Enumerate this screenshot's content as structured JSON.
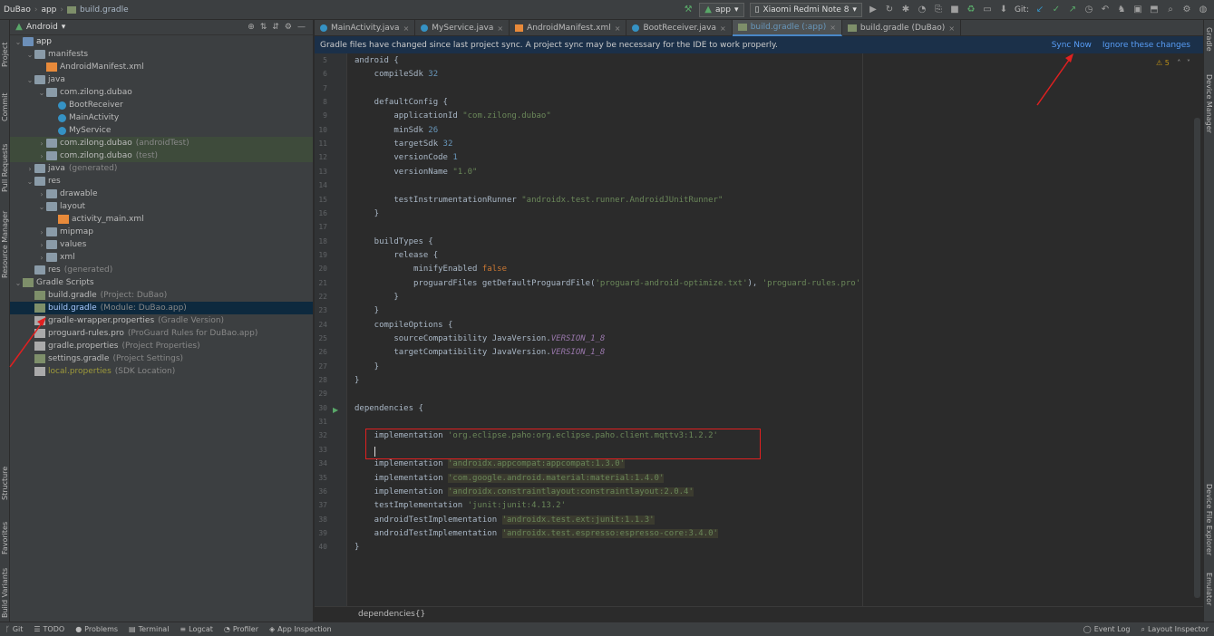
{
  "titlebar": {
    "project": "DuBao",
    "module": "app",
    "file": "build.gradle",
    "run_config": "app",
    "device": "Xiaomi Redmi Note 8",
    "git_label": "Git:"
  },
  "left_strip": [
    "Project",
    "Commit",
    "Pull Requests",
    "Resource Manager",
    "Structure",
    "Favorites",
    "Build Variants"
  ],
  "right_strip": [
    "Gradle",
    "Device Manager",
    "Device File Explorer",
    "Emulator"
  ],
  "project_panel": {
    "view": "Android",
    "tree": [
      {
        "label": "app",
        "hint": "",
        "indent": 0,
        "arrow": "v",
        "icon": "folder-blue",
        "bold": true
      },
      {
        "label": "manifests",
        "hint": "",
        "indent": 1,
        "arrow": "v",
        "icon": "folder"
      },
      {
        "label": "AndroidManifest.xml",
        "hint": "",
        "indent": 2,
        "arrow": "",
        "icon": "xml"
      },
      {
        "label": "java",
        "hint": "",
        "indent": 1,
        "arrow": "v",
        "icon": "folder"
      },
      {
        "label": "com.zilong.dubao",
        "hint": "",
        "indent": 2,
        "arrow": "v",
        "icon": "folder"
      },
      {
        "label": "BootReceiver",
        "hint": "",
        "indent": 3,
        "arrow": "",
        "icon": "class"
      },
      {
        "label": "MainActivity",
        "hint": "",
        "indent": 3,
        "arrow": "",
        "icon": "class"
      },
      {
        "label": "MyService",
        "hint": "",
        "indent": 3,
        "arrow": "",
        "icon": "class"
      },
      {
        "label": "com.zilong.dubao",
        "hint": "(androidTest)",
        "indent": 2,
        "arrow": ">",
        "icon": "folder",
        "green": true
      },
      {
        "label": "com.zilong.dubao",
        "hint": "(test)",
        "indent": 2,
        "arrow": ">",
        "icon": "folder",
        "green": true
      },
      {
        "label": "java",
        "hint": "(generated)",
        "indent": 1,
        "arrow": ">",
        "icon": "folder"
      },
      {
        "label": "res",
        "hint": "",
        "indent": 1,
        "arrow": "v",
        "icon": "folder"
      },
      {
        "label": "drawable",
        "hint": "",
        "indent": 2,
        "arrow": ">",
        "icon": "folder"
      },
      {
        "label": "layout",
        "hint": "",
        "indent": 2,
        "arrow": "v",
        "icon": "folder"
      },
      {
        "label": "activity_main.xml",
        "hint": "",
        "indent": 3,
        "arrow": "",
        "icon": "xml"
      },
      {
        "label": "mipmap",
        "hint": "",
        "indent": 2,
        "arrow": ">",
        "icon": "folder"
      },
      {
        "label": "values",
        "hint": "",
        "indent": 2,
        "arrow": ">",
        "icon": "folder"
      },
      {
        "label": "xml",
        "hint": "",
        "indent": 2,
        "arrow": ">",
        "icon": "folder"
      },
      {
        "label": "res",
        "hint": "(generated)",
        "indent": 1,
        "arrow": "",
        "icon": "folder"
      },
      {
        "label": "Gradle Scripts",
        "hint": "",
        "indent": 0,
        "arrow": "v",
        "icon": "gradle"
      },
      {
        "label": "build.gradle",
        "hint": "(Project: DuBao)",
        "indent": 1,
        "arrow": "",
        "icon": "gradle"
      },
      {
        "label": "build.gradle",
        "hint": "(Module: DuBao.app)",
        "indent": 1,
        "arrow": "",
        "icon": "gradle",
        "selected": true
      },
      {
        "label": "gradle-wrapper.properties",
        "hint": "(Gradle Version)",
        "indent": 1,
        "arrow": "",
        "icon": "prop"
      },
      {
        "label": "proguard-rules.pro",
        "hint": "(ProGuard Rules for DuBao.app)",
        "indent": 1,
        "arrow": "",
        "icon": "prop"
      },
      {
        "label": "gradle.properties",
        "hint": "(Project Properties)",
        "indent": 1,
        "arrow": "",
        "icon": "prop"
      },
      {
        "label": "settings.gradle",
        "hint": "(Project Settings)",
        "indent": 1,
        "arrow": "",
        "icon": "gradle"
      },
      {
        "label": "local.properties",
        "hint": "(SDK Location)",
        "indent": 1,
        "arrow": "",
        "icon": "prop",
        "yellow": true
      }
    ]
  },
  "tabs": [
    {
      "label": "MainActivity.java",
      "icon": "class"
    },
    {
      "label": "MyService.java",
      "icon": "class"
    },
    {
      "label": "AndroidManifest.xml",
      "icon": "xml"
    },
    {
      "label": "BootReceiver.java",
      "icon": "class"
    },
    {
      "label": "build.gradle (:app)",
      "icon": "gradle",
      "active": true
    },
    {
      "label": "build.gradle (DuBao)",
      "icon": "gradle"
    }
  ],
  "banner": {
    "message": "Gradle files have changed since last project sync. A project sync may be necessary for the IDE to work properly.",
    "sync_now": "Sync Now",
    "ignore": "Ignore these changes"
  },
  "warning_count": "5",
  "code_lines": [
    {
      "n": "5",
      "t": [
        [
          "kw",
          "android {"
        ]
      ]
    },
    {
      "n": "6",
      "t": [
        [
          "kw",
          "    compileSdk "
        ],
        [
          "num",
          "32"
        ]
      ]
    },
    {
      "n": "7",
      "t": []
    },
    {
      "n": "8",
      "t": [
        [
          "kw",
          "    defaultConfig {"
        ]
      ]
    },
    {
      "n": "9",
      "t": [
        [
          "kw",
          "        applicationId "
        ],
        [
          "str",
          "\"com.zilong.dubao\""
        ]
      ]
    },
    {
      "n": "10",
      "t": [
        [
          "kw",
          "        minSdk "
        ],
        [
          "num",
          "26"
        ]
      ]
    },
    {
      "n": "11",
      "t": [
        [
          "kw",
          "        targetSdk "
        ],
        [
          "num",
          "32"
        ]
      ]
    },
    {
      "n": "12",
      "t": [
        [
          "kw",
          "        versionCode "
        ],
        [
          "num",
          "1"
        ]
      ]
    },
    {
      "n": "13",
      "t": [
        [
          "kw",
          "        versionName "
        ],
        [
          "str",
          "\"1.0\""
        ]
      ]
    },
    {
      "n": "14",
      "t": []
    },
    {
      "n": "15",
      "t": [
        [
          "kw",
          "        testInstrumentationRunner "
        ],
        [
          "str",
          "\"androidx.test.runner.AndroidJUnitRunner\""
        ]
      ]
    },
    {
      "n": "16",
      "t": [
        [
          "kw",
          "    }"
        ]
      ]
    },
    {
      "n": "17",
      "t": []
    },
    {
      "n": "18",
      "t": [
        [
          "kw",
          "    buildTypes {"
        ]
      ]
    },
    {
      "n": "19",
      "t": [
        [
          "kw",
          "        release {"
        ]
      ]
    },
    {
      "n": "20",
      "t": [
        [
          "kw",
          "            minifyEnabled "
        ],
        [
          "fal",
          "false"
        ]
      ]
    },
    {
      "n": "21",
      "t": [
        [
          "kw",
          "            proguardFiles getDefaultProguardFile("
        ],
        [
          "str",
          "'proguard-android-optimize.txt'"
        ],
        [
          "kw",
          "), "
        ],
        [
          "str",
          "'proguard-rules.pro'"
        ]
      ]
    },
    {
      "n": "22",
      "t": [
        [
          "kw",
          "        }"
        ]
      ]
    },
    {
      "n": "23",
      "t": [
        [
          "kw",
          "    }"
        ]
      ]
    },
    {
      "n": "24",
      "t": [
        [
          "kw",
          "    compileOptions {"
        ]
      ]
    },
    {
      "n": "25",
      "t": [
        [
          "kw",
          "        sourceCompatibility JavaVersion."
        ],
        [
          "ital",
          "VERSION_1_8"
        ]
      ]
    },
    {
      "n": "26",
      "t": [
        [
          "kw",
          "        targetCompatibility JavaVersion."
        ],
        [
          "ital",
          "VERSION_1_8"
        ]
      ]
    },
    {
      "n": "27",
      "t": [
        [
          "kw",
          "    }"
        ]
      ]
    },
    {
      "n": "28",
      "t": [
        [
          "kw",
          "}"
        ]
      ]
    },
    {
      "n": "29",
      "t": []
    },
    {
      "n": "30",
      "t": [
        [
          "kw",
          "dependencies {"
        ]
      ]
    },
    {
      "n": "31",
      "t": []
    },
    {
      "n": "32",
      "t": [
        [
          "kw",
          "    implementation "
        ],
        [
          "str",
          "'org.eclipse.paho:org.eclipse.paho.client.mqttv3:1.2.2'"
        ]
      ]
    },
    {
      "n": "33",
      "t": []
    },
    {
      "n": "34",
      "t": [
        [
          "kw",
          "    implementation "
        ],
        [
          "strhl",
          "'androidx.appcompat:appcompat:1.3.0'"
        ]
      ]
    },
    {
      "n": "35",
      "t": [
        [
          "kw",
          "    implementation "
        ],
        [
          "strhl",
          "'com.google.android.material:material:1.4.0'"
        ]
      ]
    },
    {
      "n": "36",
      "t": [
        [
          "kw",
          "    implementation "
        ],
        [
          "strhl",
          "'androidx.constraintlayout:constraintlayout:2.0.4'"
        ]
      ]
    },
    {
      "n": "37",
      "t": [
        [
          "kw",
          "    testImplementation "
        ],
        [
          "str",
          "'junit:junit:4.13.2'"
        ]
      ]
    },
    {
      "n": "38",
      "t": [
        [
          "kw",
          "    androidTestImplementation "
        ],
        [
          "strhl",
          "'androidx.test.ext:junit:1.1.3'"
        ]
      ]
    },
    {
      "n": "39",
      "t": [
        [
          "kw",
          "    androidTestImplementation "
        ],
        [
          "strhl",
          "'androidx.test.espresso:espresso-core:3.4.0'"
        ]
      ]
    },
    {
      "n": "40",
      "t": [
        [
          "kw",
          "}"
        ]
      ]
    }
  ],
  "breadcrumb": "dependencies{}",
  "bottom_tools": [
    "Git",
    "TODO",
    "Problems",
    "Terminal",
    "Logcat",
    "Profiler",
    "App Inspection"
  ],
  "bottom_right": [
    "Event Log",
    "Layout Inspector"
  ],
  "colors": {
    "accent": "#4a88c7",
    "annotation": "#e02020"
  }
}
